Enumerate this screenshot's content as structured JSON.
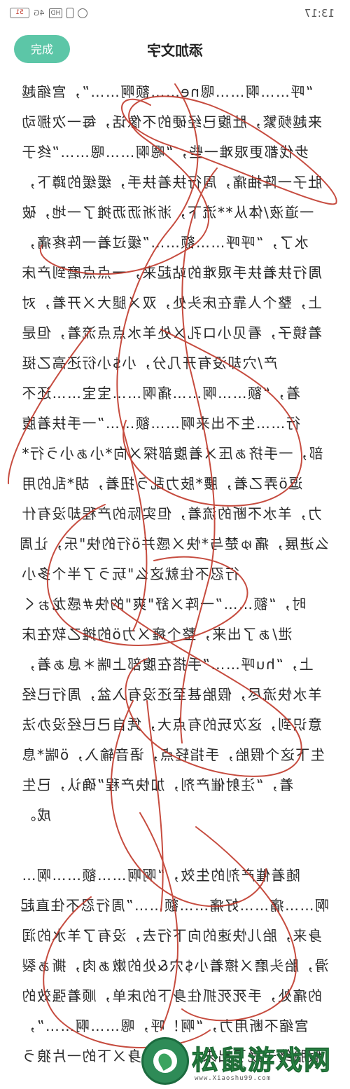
{
  "status_bar": {
    "time": "13:17",
    "battery": "51",
    "network": "4G",
    "hd": "HD"
  },
  "header": {
    "done_label": "完成",
    "title": "添加文字"
  },
  "content": {
    "lines": [
      "“呼……啊……嗯ne……额啊……”，宫缩越",
      "来越频繁，肚腹已经硬的不像话，每一次挪动",
      "步伐都更艰难一些，“嗯啊……嗯……”终于",
      "肚子一阵抽痛，周行扶着扶手，缓缓的蹲下，",
      "一道液/体从**流下，淅淅沥沥摊了一地，破",
      "水了，“呼呼……额……”缓过着一阵疼痛，",
      "周行扶着扶手艰难的站起来，一点点磨到产床",
      "上，整个人靠在床头处，双ㄨ腿大ㄨ开着，对",
      "着镜子，看见小ロ孔ㄨ处羊水点点流着，但是",
      "产/穴却没有开几分，小$小衍还高乙挺",
      "着，“额……啊……痛啊……宝宝……还不",
      "行……生不出来啊……额……”一手扶着腹",
      "部，一手挤ぁ压ㄨ着腹部探ㄨ向*小ぁ小う行*",
      "逗ö弄乙着，腰*肢力乱う扭着，胡*乱的用",
      "力，羊水不断的流着，但实际的产程却没有什",
      "么进展，痛ゅ楚与*快ㄨ感并ö行的快\"乐，让周",
      "行忍不住就这么\"玩う了半个多小",
      "时，“额……”一阵ㄨ舒\"爽\"的快#感龙ぉく",
      "泄/ぁ了出来，整个瘫ㄨ力ö的摊乙软在床",
      "上，“hu呼……”手搭在腹部上喘＊息ぁ着，",
      "羊水快流尽，假胎甚至还没有入盆，周行已经",
      "意识到，这次玩的有点大，凭自己已经没办法",
      "生下这个假胎，手指轻点，语音输入，ö喘*息",
      "着，“注射催产剂，加快产程”确认，已生",
      "成。",
      "",
      "随着催产剂的生效，“啊啊……额……啊…",
      "啊……痛……好痛……额……”周行忍不住直起",
      "身来，胎儿快速的向下行去，没有了羊水的润",
      "滑，胎头磨ㄨ擦着小$穴&处的嫩ぁ肉，撕ぁ裂",
      "的痛处，手死死抓住身下的床单，顺着强效的",
      "宫缩不断用力，“啊！呼，嗯……啊……”，",
      "假胎终于娩了出来，管不了身ㄨ下的一片狼う"
    ]
  },
  "watermark": {
    "brand": "松鼠游戏网",
    "url": "www.Xiaoshu99.com"
  },
  "colors": {
    "accent": "#5cc6a7",
    "scribble": "#c0392b",
    "watermark": "#2f9c4f"
  }
}
